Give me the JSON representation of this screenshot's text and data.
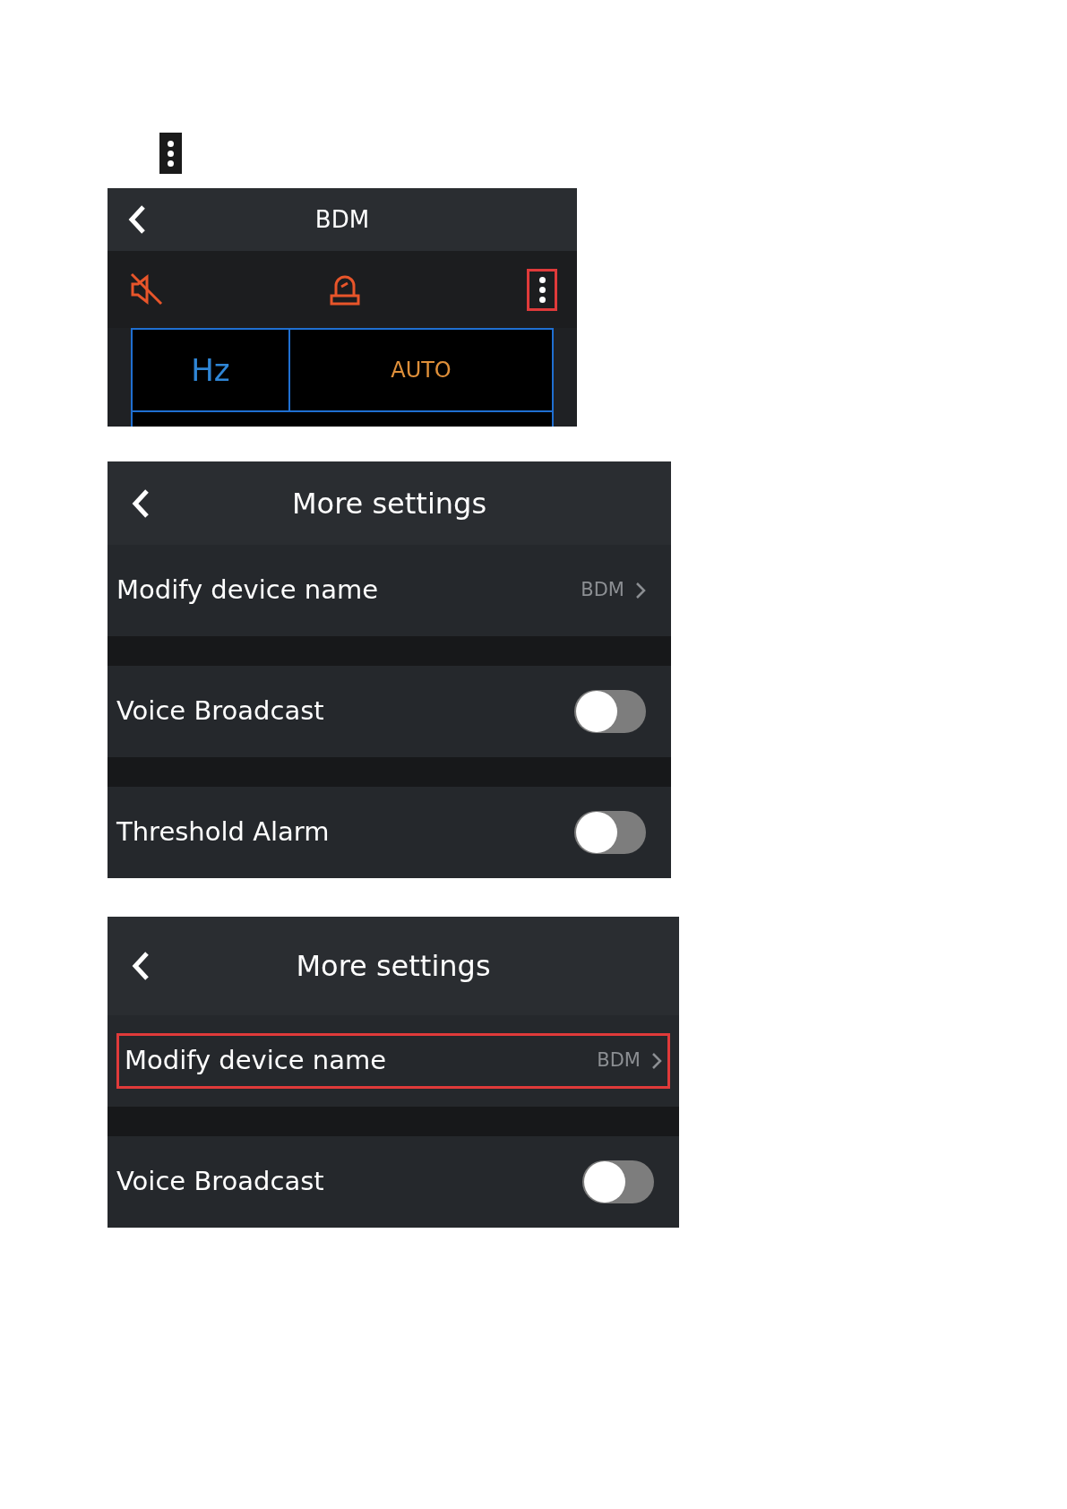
{
  "screens": [
    {
      "kind": "device",
      "title": "BDM",
      "menu_highlighted": true,
      "cells": [
        {
          "text": "Hz",
          "color": "#2f86d6"
        },
        {
          "text": "AUTO",
          "color": "#e0903a"
        }
      ]
    },
    {
      "kind": "settings",
      "title": "More settings",
      "rows": [
        {
          "kind": "link",
          "label": "Modify device name",
          "value": "BDM",
          "highlighted": false
        },
        {
          "kind": "toggle",
          "label": "Voice Broadcast",
          "on": false
        },
        {
          "kind": "toggle",
          "label": "Threshold Alarm",
          "on": false
        }
      ]
    },
    {
      "kind": "settings",
      "title": "More settings",
      "rows": [
        {
          "kind": "link",
          "label": "Modify device name",
          "value": "BDM",
          "highlighted": true
        },
        {
          "kind": "toggle",
          "label": "Voice Broadcast",
          "on": false
        }
      ]
    }
  ]
}
